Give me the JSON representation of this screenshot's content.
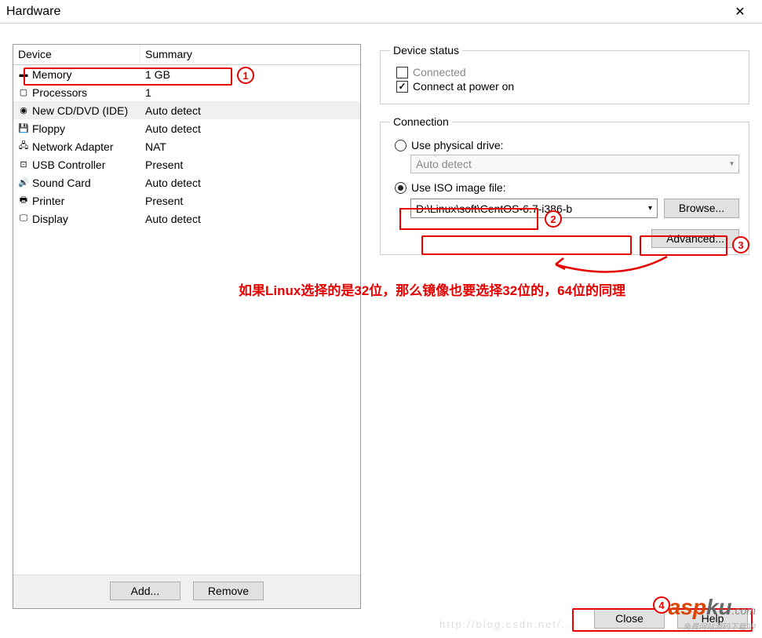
{
  "window": {
    "title": "Hardware"
  },
  "table": {
    "col1": "Device",
    "col2": "Summary"
  },
  "devices": [
    {
      "icon": "memory-icon",
      "name": "Memory",
      "summary": "1 GB"
    },
    {
      "icon": "cpu-icon",
      "name": "Processors",
      "summary": "1"
    },
    {
      "icon": "cd-icon",
      "name": "New CD/DVD (IDE)",
      "summary": "Auto detect",
      "selected": true
    },
    {
      "icon": "floppy-icon",
      "name": "Floppy",
      "summary": "Auto detect"
    },
    {
      "icon": "net-icon",
      "name": "Network Adapter",
      "summary": "NAT"
    },
    {
      "icon": "usb-icon",
      "name": "USB Controller",
      "summary": "Present"
    },
    {
      "icon": "sound-icon",
      "name": "Sound Card",
      "summary": "Auto detect"
    },
    {
      "icon": "printer-icon",
      "name": "Printer",
      "summary": "Present"
    },
    {
      "icon": "display-icon",
      "name": "Display",
      "summary": "Auto detect"
    }
  ],
  "left_buttons": {
    "add": "Add...",
    "remove": "Remove"
  },
  "status": {
    "legend": "Device status",
    "connected": "Connected",
    "power_on": "Connect at power on"
  },
  "connection": {
    "legend": "Connection",
    "physical": "Use physical drive:",
    "physical_value": "Auto detect",
    "iso": "Use ISO image file:",
    "iso_value": "D:\\Linux\\soft\\CentOS-6.7-i386-b",
    "browse": "Browse...",
    "advanced": "Advanced..."
  },
  "annotations": {
    "n1": "1",
    "n2": "2",
    "n3": "3",
    "n4": "4",
    "note": "如果Linux选择的是32位，那么镜像也要选择32位的，64位的同理"
  },
  "bottom": {
    "close": "Close",
    "help": "Help"
  },
  "watermark": {
    "asp": "asp",
    "ku": "ku",
    "com": ".com",
    "sub": "免费网站源码下载站!",
    "url": "http://blog.csdn.net/..."
  }
}
